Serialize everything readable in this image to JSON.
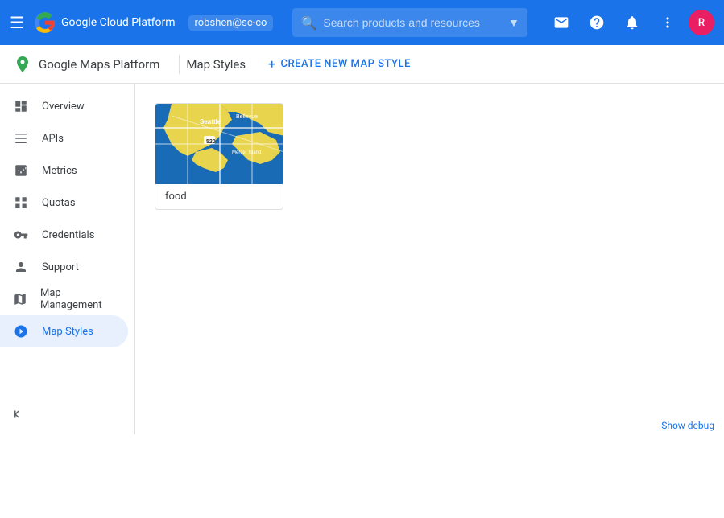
{
  "topbar": {
    "title": "Google Cloud Platform",
    "account": "robshen@sc-co",
    "search_placeholder": "Search products and resources"
  },
  "subheader": {
    "app_title": "Google Maps Platform",
    "page_title": "Map Styles",
    "create_btn_label": "CREATE NEW MAP STYLE"
  },
  "sidebar": {
    "items": [
      {
        "id": "overview",
        "label": "Overview",
        "icon": "⊙"
      },
      {
        "id": "apis",
        "label": "APIs",
        "icon": "≡"
      },
      {
        "id": "metrics",
        "label": "Metrics",
        "icon": "▦"
      },
      {
        "id": "quotas",
        "label": "Quotas",
        "icon": "▣"
      },
      {
        "id": "credentials",
        "label": "Credentials",
        "icon": "⚿"
      },
      {
        "id": "support",
        "label": "Support",
        "icon": "👤"
      },
      {
        "id": "map-management",
        "label": "Map Management",
        "icon": "▦"
      },
      {
        "id": "map-styles",
        "label": "Map Styles",
        "icon": "◎",
        "active": true
      }
    ],
    "collapse_icon": "«"
  },
  "map_styles": {
    "cards": [
      {
        "id": "food",
        "label": "food"
      }
    ]
  },
  "bottom_bar": {
    "debug_label": "Show debug"
  },
  "icons": {
    "menu": "☰",
    "search": "🔍",
    "email": "✉",
    "help": "?",
    "bell": "🔔",
    "dots": "⋮",
    "add": "+"
  }
}
